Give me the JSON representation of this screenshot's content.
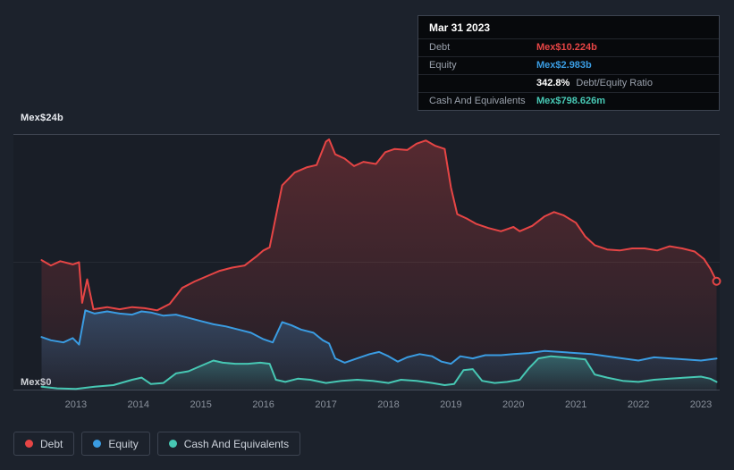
{
  "colors": {
    "background": "#1c222c",
    "grid": "#3e4450",
    "debt": "#e64545",
    "equity": "#3a9ce2",
    "cash": "#47c8b4"
  },
  "tooltip": {
    "date": "Mar 31 2023",
    "debt": {
      "label": "Debt",
      "value": "Mex$10.224b"
    },
    "equity": {
      "label": "Equity",
      "value": "Mex$2.983b"
    },
    "ratio": {
      "pct": "342.8%",
      "text": "Debt/Equity Ratio"
    },
    "cash": {
      "label": "Cash And Equivalents",
      "value": "Mex$798.626m"
    }
  },
  "axis": {
    "y_top": "Mex$24b",
    "y_bottom": "Mex$0"
  },
  "chart_data": {
    "type": "area",
    "title": "Debt vs Equity vs Cash And Equivalents over time (Mex$ billions)",
    "x_domain": [
      2012.0,
      2023.3
    ],
    "y_domain": [
      0,
      24
    ],
    "x_ticks": [
      2013,
      2014,
      2015,
      2016,
      2017,
      2018,
      2019,
      2020,
      2021,
      2022,
      2023
    ],
    "grid": true,
    "legend_position": "bottom-left",
    "series": [
      {
        "name": "Debt",
        "color": "#e64545",
        "marker_end": true,
        "points": [
          [
            2012.45,
            12.2
          ],
          [
            2012.6,
            11.7
          ],
          [
            2012.75,
            12.1
          ],
          [
            2012.95,
            11.8
          ],
          [
            2013.05,
            12.0
          ],
          [
            2013.1,
            8.2
          ],
          [
            2013.18,
            10.4
          ],
          [
            2013.28,
            7.6
          ],
          [
            2013.5,
            7.8
          ],
          [
            2013.7,
            7.6
          ],
          [
            2013.9,
            7.8
          ],
          [
            2014.1,
            7.7
          ],
          [
            2014.3,
            7.5
          ],
          [
            2014.5,
            8.1
          ],
          [
            2014.7,
            9.6
          ],
          [
            2014.9,
            10.2
          ],
          [
            2015.1,
            10.7
          ],
          [
            2015.3,
            11.2
          ],
          [
            2015.5,
            11.5
          ],
          [
            2015.7,
            11.7
          ],
          [
            2015.9,
            12.6
          ],
          [
            2016.0,
            13.1
          ],
          [
            2016.1,
            13.4
          ],
          [
            2016.3,
            19.2
          ],
          [
            2016.5,
            20.4
          ],
          [
            2016.7,
            20.9
          ],
          [
            2016.85,
            21.1
          ],
          [
            2017.0,
            23.3
          ],
          [
            2017.05,
            23.5
          ],
          [
            2017.15,
            22.1
          ],
          [
            2017.3,
            21.7
          ],
          [
            2017.45,
            21.0
          ],
          [
            2017.6,
            21.4
          ],
          [
            2017.8,
            21.2
          ],
          [
            2017.95,
            22.3
          ],
          [
            2018.1,
            22.6
          ],
          [
            2018.3,
            22.5
          ],
          [
            2018.45,
            23.1
          ],
          [
            2018.6,
            23.4
          ],
          [
            2018.75,
            22.9
          ],
          [
            2018.9,
            22.6
          ],
          [
            2019.0,
            19.0
          ],
          [
            2019.1,
            16.5
          ],
          [
            2019.25,
            16.1
          ],
          [
            2019.4,
            15.6
          ],
          [
            2019.6,
            15.2
          ],
          [
            2019.8,
            14.9
          ],
          [
            2020.0,
            15.3
          ],
          [
            2020.1,
            14.9
          ],
          [
            2020.3,
            15.4
          ],
          [
            2020.5,
            16.3
          ],
          [
            2020.65,
            16.7
          ],
          [
            2020.8,
            16.4
          ],
          [
            2021.0,
            15.7
          ],
          [
            2021.15,
            14.4
          ],
          [
            2021.3,
            13.6
          ],
          [
            2021.5,
            13.2
          ],
          [
            2021.7,
            13.1
          ],
          [
            2021.9,
            13.3
          ],
          [
            2022.1,
            13.3
          ],
          [
            2022.3,
            13.1
          ],
          [
            2022.5,
            13.5
          ],
          [
            2022.7,
            13.3
          ],
          [
            2022.9,
            13.0
          ],
          [
            2023.05,
            12.3
          ],
          [
            2023.15,
            11.4
          ],
          [
            2023.25,
            10.224
          ]
        ]
      },
      {
        "name": "Equity",
        "color": "#3a9ce2",
        "marker_end": false,
        "points": [
          [
            2012.45,
            5.0
          ],
          [
            2012.6,
            4.7
          ],
          [
            2012.8,
            4.5
          ],
          [
            2012.95,
            4.9
          ],
          [
            2013.05,
            4.3
          ],
          [
            2013.15,
            7.5
          ],
          [
            2013.3,
            7.2
          ],
          [
            2013.5,
            7.4
          ],
          [
            2013.7,
            7.2
          ],
          [
            2013.9,
            7.1
          ],
          [
            2014.05,
            7.4
          ],
          [
            2014.2,
            7.3
          ],
          [
            2014.4,
            7.0
          ],
          [
            2014.6,
            7.1
          ],
          [
            2014.8,
            6.8
          ],
          [
            2015.0,
            6.5
          ],
          [
            2015.2,
            6.2
          ],
          [
            2015.4,
            6.0
          ],
          [
            2015.6,
            5.7
          ],
          [
            2015.8,
            5.4
          ],
          [
            2016.0,
            4.8
          ],
          [
            2016.15,
            4.5
          ],
          [
            2016.3,
            6.4
          ],
          [
            2016.45,
            6.1
          ],
          [
            2016.6,
            5.7
          ],
          [
            2016.8,
            5.4
          ],
          [
            2016.95,
            4.7
          ],
          [
            2017.05,
            4.4
          ],
          [
            2017.15,
            3.0
          ],
          [
            2017.3,
            2.6
          ],
          [
            2017.5,
            3.0
          ],
          [
            2017.7,
            3.4
          ],
          [
            2017.85,
            3.6
          ],
          [
            2018.0,
            3.2
          ],
          [
            2018.15,
            2.7
          ],
          [
            2018.3,
            3.1
          ],
          [
            2018.5,
            3.4
          ],
          [
            2018.7,
            3.2
          ],
          [
            2018.85,
            2.7
          ],
          [
            2019.0,
            2.5
          ],
          [
            2019.15,
            3.2
          ],
          [
            2019.35,
            3.0
          ],
          [
            2019.55,
            3.3
          ],
          [
            2019.8,
            3.3
          ],
          [
            2020.0,
            3.4
          ],
          [
            2020.25,
            3.5
          ],
          [
            2020.5,
            3.7
          ],
          [
            2020.75,
            3.6
          ],
          [
            2021.0,
            3.5
          ],
          [
            2021.25,
            3.4
          ],
          [
            2021.5,
            3.2
          ],
          [
            2021.75,
            3.0
          ],
          [
            2022.0,
            2.8
          ],
          [
            2022.25,
            3.1
          ],
          [
            2022.5,
            3.0
          ],
          [
            2022.75,
            2.9
          ],
          [
            2023.0,
            2.8
          ],
          [
            2023.25,
            2.983
          ]
        ]
      },
      {
        "name": "Cash And Equivalents",
        "color": "#47c8b4",
        "marker_end": false,
        "points": [
          [
            2012.45,
            0.35
          ],
          [
            2012.7,
            0.2
          ],
          [
            2013.0,
            0.15
          ],
          [
            2013.3,
            0.35
          ],
          [
            2013.6,
            0.5
          ],
          [
            2013.9,
            1.0
          ],
          [
            2014.05,
            1.2
          ],
          [
            2014.2,
            0.6
          ],
          [
            2014.4,
            0.7
          ],
          [
            2014.6,
            1.6
          ],
          [
            2014.8,
            1.8
          ],
          [
            2015.0,
            2.3
          ],
          [
            2015.2,
            2.8
          ],
          [
            2015.35,
            2.6
          ],
          [
            2015.55,
            2.5
          ],
          [
            2015.75,
            2.5
          ],
          [
            2015.95,
            2.6
          ],
          [
            2016.1,
            2.5
          ],
          [
            2016.2,
            1.0
          ],
          [
            2016.35,
            0.8
          ],
          [
            2016.55,
            1.1
          ],
          [
            2016.75,
            1.0
          ],
          [
            2017.0,
            0.7
          ],
          [
            2017.25,
            0.9
          ],
          [
            2017.5,
            1.0
          ],
          [
            2017.75,
            0.9
          ],
          [
            2018.0,
            0.7
          ],
          [
            2018.2,
            1.0
          ],
          [
            2018.45,
            0.9
          ],
          [
            2018.7,
            0.7
          ],
          [
            2018.9,
            0.5
          ],
          [
            2019.05,
            0.6
          ],
          [
            2019.2,
            1.9
          ],
          [
            2019.35,
            2.0
          ],
          [
            2019.5,
            0.9
          ],
          [
            2019.7,
            0.7
          ],
          [
            2019.9,
            0.8
          ],
          [
            2020.1,
            1.0
          ],
          [
            2020.25,
            2.1
          ],
          [
            2020.4,
            3.0
          ],
          [
            2020.6,
            3.2
          ],
          [
            2020.8,
            3.1
          ],
          [
            2021.0,
            3.0
          ],
          [
            2021.15,
            2.9
          ],
          [
            2021.3,
            1.5
          ],
          [
            2021.5,
            1.2
          ],
          [
            2021.75,
            0.9
          ],
          [
            2022.0,
            0.8
          ],
          [
            2022.25,
            1.0
          ],
          [
            2022.5,
            1.1
          ],
          [
            2022.75,
            1.2
          ],
          [
            2023.0,
            1.3
          ],
          [
            2023.15,
            1.1
          ],
          [
            2023.25,
            0.799
          ]
        ]
      }
    ]
  }
}
